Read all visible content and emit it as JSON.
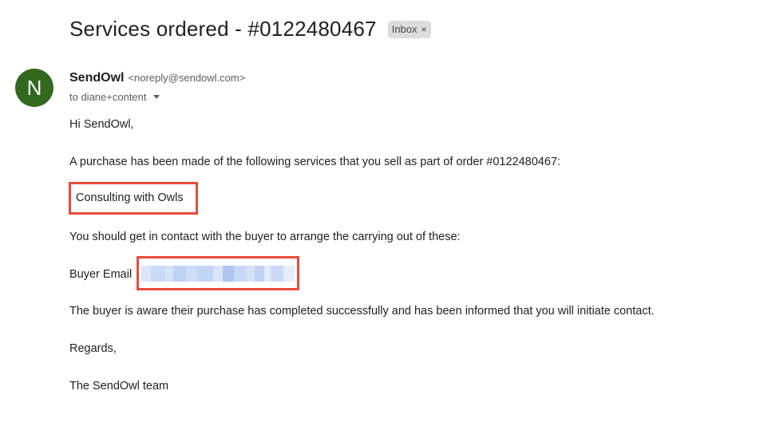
{
  "message": {
    "subject": "Services ordered - #0122480467",
    "label": "Inbox",
    "label_remove_glyph": "×",
    "sender": {
      "initial": "N",
      "name": "SendOwl",
      "email": "<noreply@sendowl.com>",
      "to": "to diane+content"
    },
    "body": {
      "greeting": "Hi SendOwl,",
      "intro": "A purchase has been made of the following services that you sell as part of order #0122480467:",
      "service": "Consulting with Owls",
      "instruction": "You should get in contact with the buyer to arrange the carrying out of these:",
      "buyer_email_label": "Buyer Email",
      "buyer_email_value": "",
      "notice": "The buyer is aware their purchase has completed successfully and has been informed that you will initiate contact.",
      "closing": "Regards,",
      "signature": "The SendOwl team"
    }
  },
  "colors": {
    "avatar": "#33691e",
    "highlight": "#e74c3c",
    "redacted_blue": "#c6d7f5"
  }
}
